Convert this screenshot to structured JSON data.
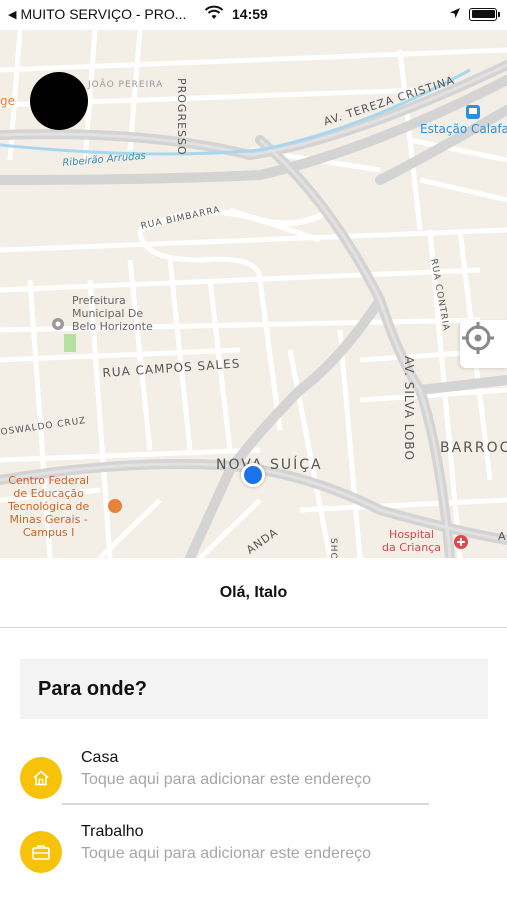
{
  "status_bar": {
    "back_label": "MUITO SERVIÇO - PRO...",
    "time": "14:59"
  },
  "map": {
    "labels": {
      "progresso": "PROGRESSO",
      "joao_pereira": "JOÃO PEREIRA",
      "ge": "ge",
      "tereza": "AV. TEREZA CRISTINA",
      "estacao": "Estação Calafate",
      "arrudas": "Ribeirão Arrudas",
      "bimbarra": "RUA BIMBARRA",
      "contria": "RUA CONTRIA",
      "prefeitura": "Prefeitura\nMunicipal De\nBelo Horizonte",
      "campos_sales": "RUA CAMPOS SALES",
      "silva_lobo": "AV. SILVA LOBO",
      "oswaldo": "OSWALDO CRUZ",
      "barroca": "BARROCA",
      "nova_suica": "NOVA SUÍÇA",
      "cefet": "Centro Federal\nde Educação\nTecnológica de\nMinas Gerais -\nCampus I",
      "hospital": "Hospital\nda Criança",
      "anda": "ANDA",
      "sho": "SHO",
      "a": "A"
    },
    "colors": {
      "background": "#f3efe6",
      "road": "#ffffff",
      "highway": "#d4d4d4",
      "river": "#a8d8ef",
      "user_dot": "#1a73e8",
      "poi_blue": "#2f8fd8",
      "poi_red": "#e0474b",
      "poi_orange": "#e6823a"
    }
  },
  "greeting": "Olá, Italo",
  "destination": {
    "label": "Para onde?"
  },
  "places": [
    {
      "title": "Casa",
      "subtitle": "Toque aqui para adicionar este endereço",
      "icon": "home-icon"
    },
    {
      "title": "Trabalho",
      "subtitle": "Toque aqui para adicionar este endereço",
      "icon": "briefcase-icon"
    }
  ],
  "accent_color": "#f7c20a"
}
